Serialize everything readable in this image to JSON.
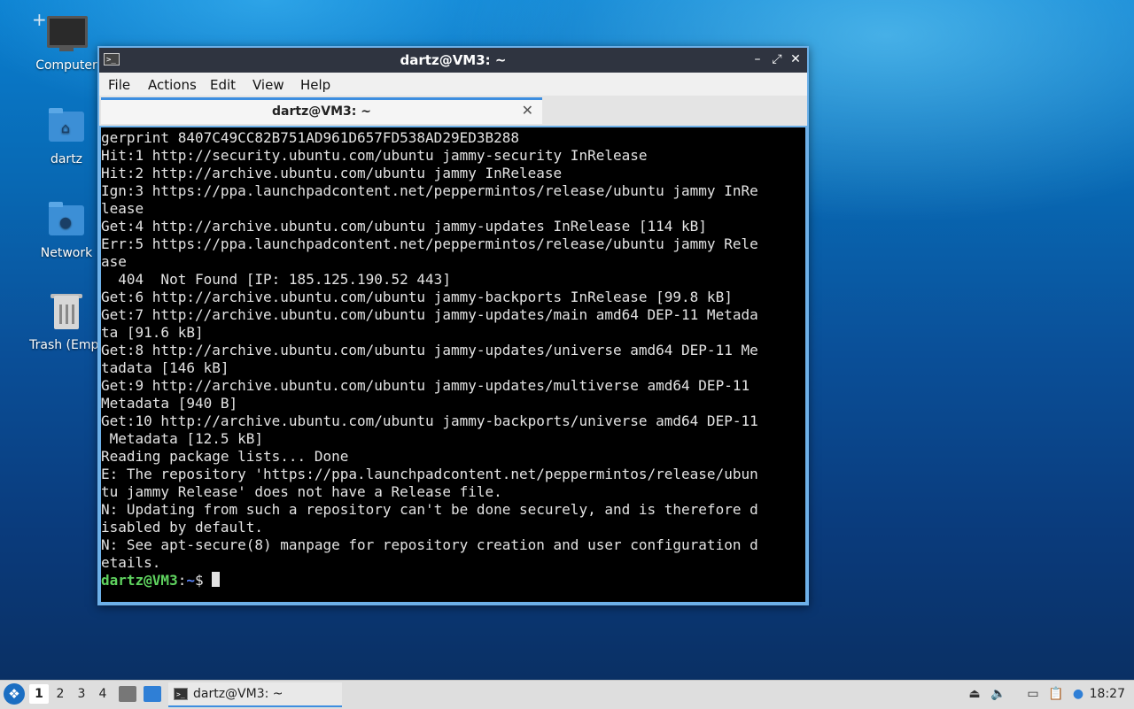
{
  "desktop": {
    "icons": [
      {
        "label": "Computer"
      },
      {
        "label": "dartz"
      },
      {
        "label": "Network"
      },
      {
        "label": "Trash (Empt"
      }
    ]
  },
  "window": {
    "title": "dartz@VM3: ~",
    "controls": {
      "minimize": "–",
      "maximize": "⤢",
      "close": "✕"
    },
    "menu": [
      "File",
      "Actions",
      "Edit",
      "View",
      "Help"
    ],
    "tab": {
      "label": "dartz@VM3: ~",
      "close": "✕"
    }
  },
  "terminal": {
    "output": "gerprint 8407C49CC82B751AD961D657FD538AD29ED3B288\nHit:1 http://security.ubuntu.com/ubuntu jammy-security InRelease\nHit:2 http://archive.ubuntu.com/ubuntu jammy InRelease\nIgn:3 https://ppa.launchpadcontent.net/peppermintos/release/ubuntu jammy InRe\nlease\nGet:4 http://archive.ubuntu.com/ubuntu jammy-updates InRelease [114 kB]\nErr:5 https://ppa.launchpadcontent.net/peppermintos/release/ubuntu jammy Rele\nase\n  404  Not Found [IP: 185.125.190.52 443]\nGet:6 http://archive.ubuntu.com/ubuntu jammy-backports InRelease [99.8 kB]\nGet:7 http://archive.ubuntu.com/ubuntu jammy-updates/main amd64 DEP-11 Metada\nta [91.6 kB]\nGet:8 http://archive.ubuntu.com/ubuntu jammy-updates/universe amd64 DEP-11 Me\ntadata [146 kB]\nGet:9 http://archive.ubuntu.com/ubuntu jammy-updates/multiverse amd64 DEP-11\nMetadata [940 B]\nGet:10 http://archive.ubuntu.com/ubuntu jammy-backports/universe amd64 DEP-11\n Metadata [12.5 kB]\nReading package lists... Done\nE: The repository 'https://ppa.launchpadcontent.net/peppermintos/release/ubun\ntu jammy Release' does not have a Release file.\nN: Updating from such a repository can't be done securely, and is therefore d\nisabled by default.\nN: See apt-secure(8) manpage for repository creation and user configuration d\netails.",
    "prompt_user": "dartz@VM3",
    "prompt_sep": ":",
    "prompt_path": "~",
    "prompt_symbol": "$ "
  },
  "taskbar": {
    "start_icon": "start-menu-icon",
    "workspaces": [
      "1",
      "2",
      "3",
      "4"
    ],
    "active_workspace": "1",
    "task_label": "dartz@VM3: ~",
    "clock": "18:27"
  }
}
